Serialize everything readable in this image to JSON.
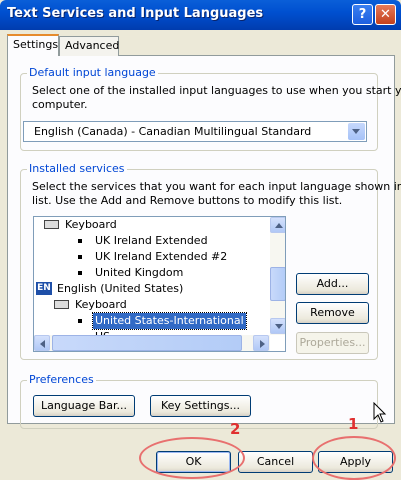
{
  "window": {
    "title": "Text Services and Input Languages",
    "help_icon": "?",
    "close_icon": "✕"
  },
  "tabs": [
    {
      "label": "Settings",
      "active": true
    },
    {
      "label": "Advanced",
      "active": false
    }
  ],
  "default_input_language": {
    "group_label": "Default input language",
    "description_line1": "Select one of the installed input languages to use when you start your",
    "description_line2": "computer.",
    "selected_value": "English (Canada) - Canadian Multilingual Standard"
  },
  "installed_services": {
    "group_label": "Installed services",
    "description_line1": "Select the services that you want for each input language shown in the",
    "description_line2": "list. Use the Add and Remove buttons to modify this list.",
    "tree": [
      {
        "label": "Keyboard",
        "type": "keyboard"
      },
      {
        "label": "UK Ireland Extended",
        "type": "layout"
      },
      {
        "label": "UK Ireland Extended #2",
        "type": "layout"
      },
      {
        "label": "United Kingdom",
        "type": "layout"
      },
      {
        "label": "English (United States)",
        "type": "language",
        "badge": "EN"
      },
      {
        "label": "Keyboard",
        "type": "keyboard"
      },
      {
        "label": "United States-International",
        "type": "layout",
        "selected": true
      },
      {
        "label": "US",
        "type": "layout"
      }
    ],
    "buttons": {
      "add": "Add...",
      "remove": "Remove",
      "properties": "Properties..."
    }
  },
  "preferences": {
    "group_label": "Preferences",
    "language_bar_button": "Language Bar...",
    "key_settings_button": "Key Settings..."
  },
  "footer": {
    "ok": "OK",
    "cancel": "Cancel",
    "apply": "Apply"
  },
  "annotations": {
    "apply_marker": "1",
    "ok_marker": "2",
    "marker_color": "#e03030"
  }
}
